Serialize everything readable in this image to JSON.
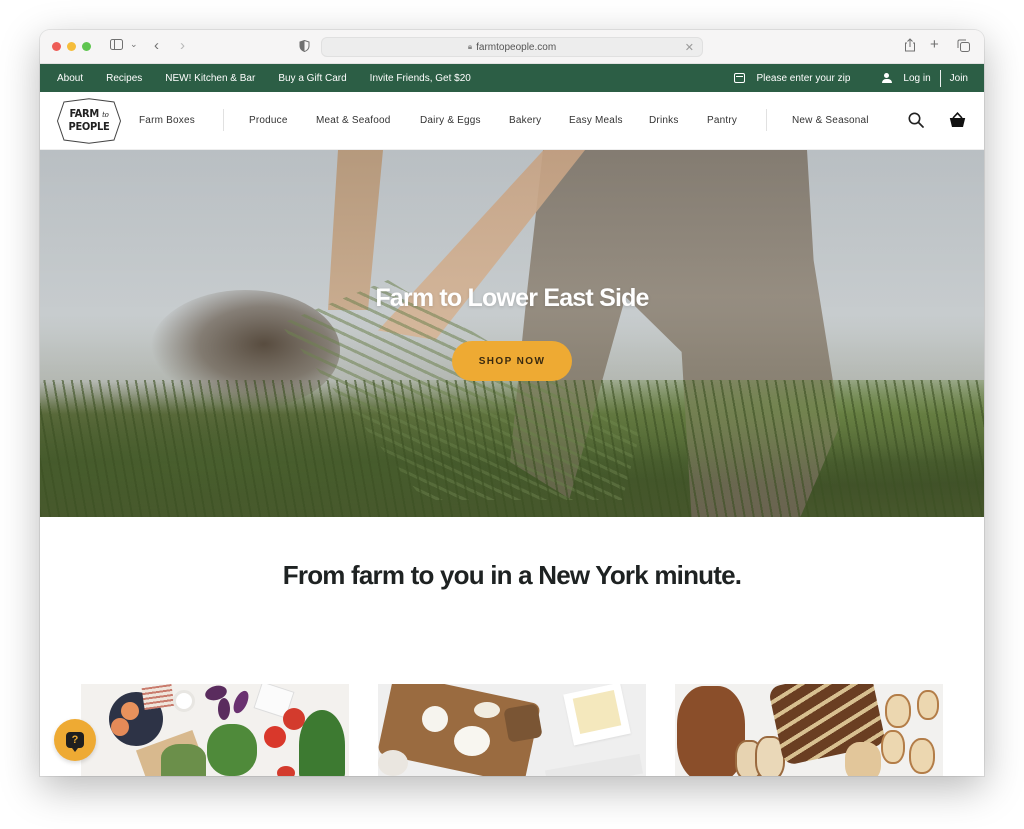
{
  "browser": {
    "url": "farmtopeople.com",
    "icons": [
      "sidebar-icon",
      "chevron-down-icon",
      "back-icon",
      "forward-icon",
      "privacy-shield-icon",
      "lock-icon",
      "clear-icon",
      "share-icon",
      "new-tab-icon",
      "tab-overview-icon"
    ]
  },
  "topbar": {
    "links": [
      "About",
      "Recipes",
      "NEW! Kitchen & Bar",
      "Buy a Gift Card",
      "Invite Friends, Get $20"
    ],
    "zip_prompt": "Please enter your zip",
    "login": "Log in",
    "join": "Join",
    "bg_color": "#2c5e45"
  },
  "nav": {
    "logo": {
      "line1": "FARM",
      "to": "to",
      "line2": "PEOPLE"
    },
    "farm_boxes": "Farm Boxes",
    "categories": [
      "Produce",
      "Meat & Seafood",
      "Dairy & Eggs",
      "Bakery",
      "Easy Meals",
      "Drinks",
      "Pantry"
    ],
    "new_seasonal": "New & Seasonal",
    "icons": [
      "search-icon",
      "basket-icon"
    ]
  },
  "hero": {
    "title": "Farm to Lower East Side",
    "cta": "SHOP NOW",
    "cta_color": "#eeaa33"
  },
  "tagline": "From farm to you in a New York minute.",
  "cards": [
    {
      "subject": "produce-photo"
    },
    {
      "subject": "dairy-cheese-photo"
    },
    {
      "subject": "bakery-bread-photo"
    }
  ],
  "help": {
    "icon": "help-chat-icon",
    "glyph": "?"
  }
}
